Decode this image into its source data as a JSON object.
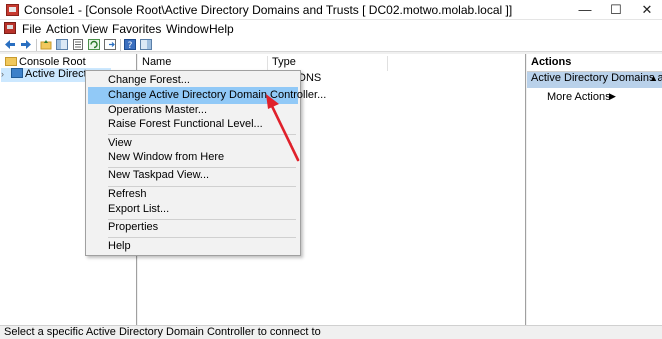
{
  "window": {
    "title": "Console1 - [Console Root\\Active Directory Domains and Trusts [ DC02.motwo.molab.local ]]",
    "minimize": "—",
    "maximize": "☐",
    "close": "✕"
  },
  "menubar": {
    "items": [
      "File",
      "Action",
      "View",
      "Favorites",
      "Window",
      "Help"
    ]
  },
  "tree": {
    "root_label": "Console Root",
    "child_label": "Active Directory"
  },
  "center": {
    "columns": [
      "Name",
      "Type"
    ],
    "row_fragment": "DNS"
  },
  "actions": {
    "header": "Actions",
    "section_title": "Active Directory Domains and ...",
    "more_actions": "More Actions"
  },
  "context_menu": {
    "items": [
      {
        "label": "Change Forest..."
      },
      {
        "label": "Change Active Directory Domain Controller..."
      },
      {
        "label": "Operations Master..."
      },
      {
        "label": "Raise Forest Functional Level..."
      },
      {
        "label": "View"
      },
      {
        "label": "New Window from Here"
      },
      {
        "label": "New Taskpad View..."
      },
      {
        "label": "Refresh"
      },
      {
        "label": "Export List..."
      },
      {
        "label": "Properties"
      },
      {
        "label": "Help"
      }
    ],
    "highlight_color": "#91c9f7"
  },
  "status": {
    "text": "Select a specific Active Directory Domain Controller to connect to"
  },
  "colors": {
    "annotation_arrow": "#e0212b",
    "selection": "#cce8ff",
    "actions_section": "#b9d1ea"
  }
}
